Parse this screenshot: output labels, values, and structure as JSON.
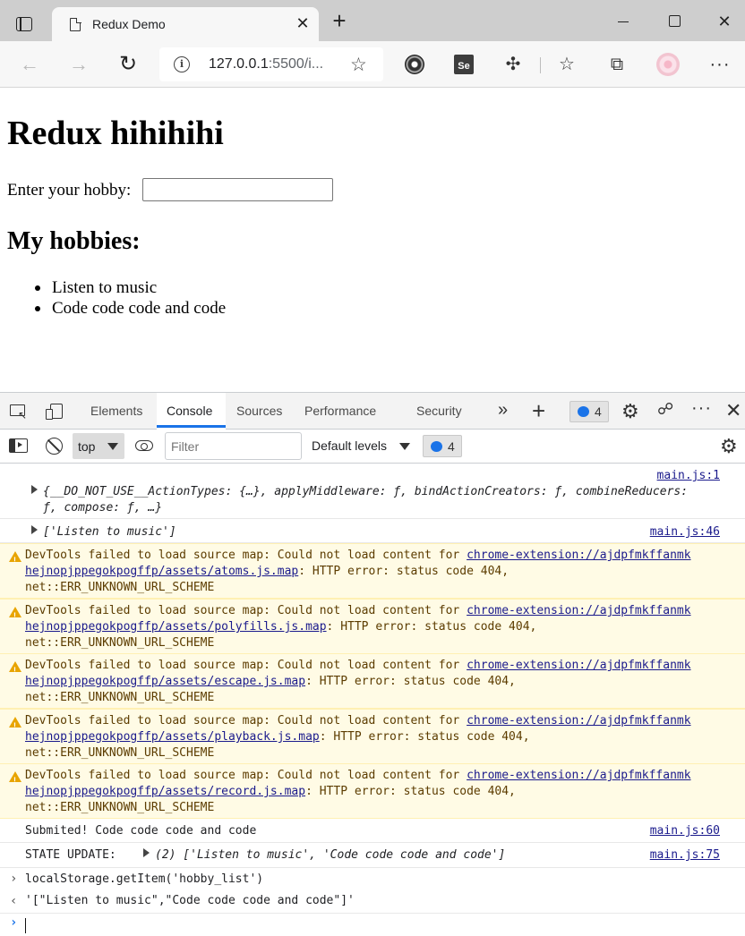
{
  "browser": {
    "tab_title": "Redux Demo",
    "new_tab_symbol": "+",
    "url_main": "127.0.0.1",
    "url_rest": ":5500/i..."
  },
  "page": {
    "heading": "Redux hihihihi",
    "hobby_label": "Enter your hobby:",
    "hobby_input_value": "",
    "list_heading": "My hobbies:",
    "hobbies": [
      "Listen to music",
      "Code code code and code"
    ]
  },
  "devtools": {
    "tabs": [
      "Elements",
      "Console",
      "Sources",
      "Performance",
      "Security"
    ],
    "active_tab": "Console",
    "issues_count": "4",
    "context": "top",
    "filter_placeholder": "Filter",
    "levels": "Default levels",
    "console_issues_count": "4"
  },
  "console": {
    "log1": {
      "source": "main.js:1",
      "line1": "{__DO_NOT_USE__ActionTypes: {…}, applyMiddleware: ƒ, bindActionCreators: ƒ, combineReducers:",
      "line2": "ƒ, compose: ƒ, …}"
    },
    "log2": {
      "source": "main.js:46",
      "text": "['Listen to music']"
    },
    "warnings": [
      {
        "prefix": "DevTools failed to load source map: Could not load content for ",
        "link1": "chrome-extension://ajdpfmkffanmk",
        "link2": "hejnopjppegokpogffp/assets/atoms.js.map",
        "suffix": ": HTTP error: status code 404,",
        "line3": "net::ERR_UNKNOWN_URL_SCHEME"
      },
      {
        "prefix": "DevTools failed to load source map: Could not load content for ",
        "link1": "chrome-extension://ajdpfmkffanmk",
        "link2": "hejnopjppegokpogffp/assets/polyfills.js.map",
        "suffix": ": HTTP error: status code 404,",
        "line3": "net::ERR_UNKNOWN_URL_SCHEME"
      },
      {
        "prefix": "DevTools failed to load source map: Could not load content for ",
        "link1": "chrome-extension://ajdpfmkffanmk",
        "link2": "hejnopjppegokpogffp/assets/escape.js.map",
        "suffix": ": HTTP error: status code 404,",
        "line3": "net::ERR_UNKNOWN_URL_SCHEME"
      },
      {
        "prefix": "DevTools failed to load source map: Could not load content for ",
        "link1": "chrome-extension://ajdpfmkffanmk",
        "link2": "hejnopjppegokpogffp/assets/playback.js.map",
        "suffix": ": HTTP error: status code 404,",
        "line3": "net::ERR_UNKNOWN_URL_SCHEME"
      },
      {
        "prefix": "DevTools failed to load source map: Could not load content for ",
        "link1": "chrome-extension://ajdpfmkffanmk",
        "link2": "hejnopjppegokpogffp/assets/record.js.map",
        "suffix": ": HTTP error: status code 404,",
        "line3": "net::ERR_UNKNOWN_URL_SCHEME"
      }
    ],
    "submitted": {
      "text": "Submited! Code code code and code",
      "source": "main.js:60"
    },
    "state_update": {
      "label": "STATE UPDATE:",
      "value": "(2) ['Listen to music', 'Code code code and code']",
      "source": "main.js:75"
    },
    "input_cmd": "localStorage.getItem('hobby_list')",
    "result": "'[\"Listen to music\",\"Code code code and code\"]'"
  }
}
